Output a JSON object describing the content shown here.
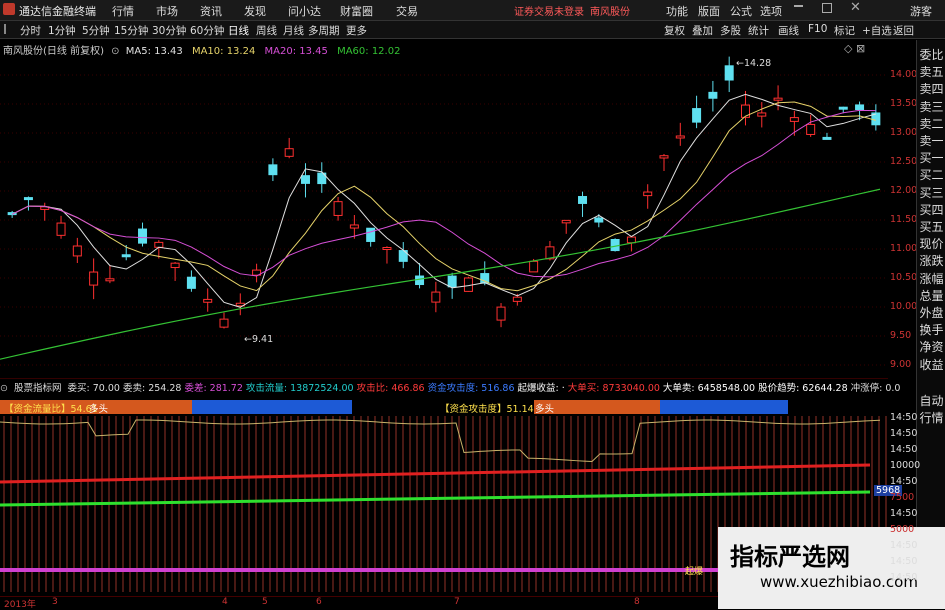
{
  "app": {
    "title": "通达信金融终端",
    "notice": "证券交易未登录",
    "stock_link": "南风股份"
  },
  "menu": [
    "行情",
    "市场",
    "资讯",
    "发现",
    "问小达",
    "财富圈",
    "交易"
  ],
  "title_right": [
    "功能",
    "版面",
    "公式",
    "选项",
    "游客"
  ],
  "toolbar": {
    "periods": [
      "分时",
      "1分钟",
      "5分钟",
      "15分钟",
      "30分钟",
      "60分钟",
      "日线",
      "周线",
      "月线",
      "多周期",
      "更多"
    ],
    "active": "日线",
    "right": [
      "复权",
      "叠加",
      "多股",
      "统计",
      "画线",
      "F10",
      "标记",
      "+自选",
      "返回"
    ]
  },
  "main": {
    "stock_label": "南风股份(日线 前复权)",
    "ma": [
      {
        "label": "MA5: 13.43",
        "color": "#e0e0e0"
      },
      {
        "label": "MA10: 13.24",
        "color": "#e6d36a"
      },
      {
        "label": "MA20: 13.45",
        "color": "#d64fd6"
      },
      {
        "label": "MA60: 12.02",
        "color": "#34c234"
      }
    ],
    "high_label": "14.28",
    "low_label": "9.41",
    "price_axis": [
      "14.00",
      "13.50",
      "13.00",
      "12.50",
      "12.00",
      "11.50",
      "11.00",
      "10.50",
      "10.00",
      "9.50",
      "9.00"
    ]
  },
  "right_panel": [
    "委比",
    "卖五",
    "卖四",
    "卖三",
    "卖二",
    "卖一",
    "买一",
    "买二",
    "买三",
    "买四",
    "买五",
    "现价",
    "涨跌",
    "涨幅",
    "总量",
    "外盘",
    "换手",
    "净资",
    "收益",
    "自动",
    "行情"
  ],
  "indicator": {
    "name": "股票指标网",
    "fields": [
      {
        "text": "委买: 70.00",
        "color": "#dddddd"
      },
      {
        "text": "委卖: 254.28",
        "color": "#dddddd"
      },
      {
        "text": "委差: 281.72",
        "color": "#d64fd6"
      },
      {
        "text": "攻击流量: 13872524.00",
        "color": "#22cccc"
      },
      {
        "text": "攻击比: 466.86",
        "color": "#ff3b3b"
      },
      {
        "text": "资金攻击度: 516.86",
        "color": "#3b7bff"
      },
      {
        "text": "起爆收益: ·",
        "color": "#ffffff"
      },
      {
        "text": "大单买: 8733040.00",
        "color": "#ff3b3b"
      },
      {
        "text": "大单卖: 6458548.00",
        "color": "#ffffff"
      },
      {
        "text": "股价趋势: 62644.28",
        "color": "#ffffff"
      },
      {
        "text": "冲涨停: 0.0",
        "color": "#dddddd"
      }
    ],
    "bar1_label": "【资金流量比】54.61",
    "bar1_tag": "多头",
    "bar2_label": "【资金攻击度】51.14",
    "bar2_tag": "多头",
    "axis": [
      "14:50",
      "14:50",
      "14:50",
      "10000",
      "14:50",
      "7500",
      "14:50",
      "5000",
      "14:50",
      "14:50",
      "14:50"
    ],
    "value_badge": "5968",
    "marker": "起爆"
  },
  "bottom_axis": [
    "2013年",
    "3",
    "4",
    "5",
    "6",
    "7",
    "8"
  ],
  "watermark": {
    "line1": "指标严选网",
    "line2": "www.xuezhibiao.com"
  }
}
